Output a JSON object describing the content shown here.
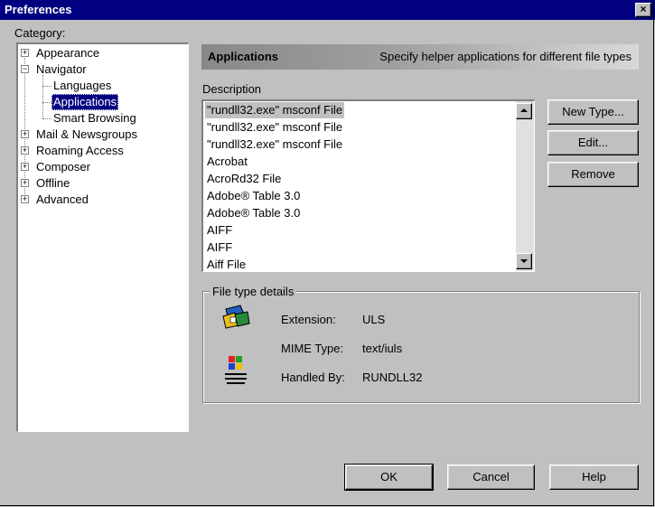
{
  "window": {
    "title": "Preferences",
    "close_glyph": "×"
  },
  "category": {
    "label": "Category:",
    "items": [
      {
        "label": "Appearance",
        "expander": "+"
      },
      {
        "label": "Navigator",
        "expander": "−"
      },
      {
        "label": "Languages",
        "expander": ""
      },
      {
        "label": "Applications",
        "expander": "",
        "selected": true
      },
      {
        "label": "Smart Browsing",
        "expander": ""
      },
      {
        "label": "Mail & Newsgroups",
        "expander": "+"
      },
      {
        "label": "Roaming Access",
        "expander": "+"
      },
      {
        "label": "Composer",
        "expander": "+"
      },
      {
        "label": "Offline",
        "expander": "+"
      },
      {
        "label": "Advanced",
        "expander": "+"
      }
    ]
  },
  "panel": {
    "title": "Applications",
    "description": "Specify helper applications for different file types"
  },
  "list": {
    "label": "Description",
    "rows": [
      "\"rundll32.exe\" msconf File",
      "\"rundll32.exe\" msconf File",
      "\"rundll32.exe\" msconf File",
      "Acrobat",
      "AcroRd32 File",
      "Adobe® Table 3.0",
      "Adobe® Table 3.0",
      "AIFF",
      "AIFF",
      "Aiff File"
    ]
  },
  "buttons": {
    "new_type": "New Type...",
    "edit": "Edit...",
    "remove": "Remove",
    "ok": "OK",
    "cancel": "Cancel",
    "help": "Help"
  },
  "details": {
    "title": "File type details",
    "extension_label": "Extension:",
    "extension_value": "ULS",
    "mime_label": "MIME Type:",
    "mime_value": "text/iuls",
    "handled_label": "Handled By:",
    "handled_value": "RUNDLL32",
    "icons": [
      "file-type-icon",
      "microsoft-windows-logo-icon"
    ],
    "logo_text": "MICROSOFT WINDOWS"
  }
}
